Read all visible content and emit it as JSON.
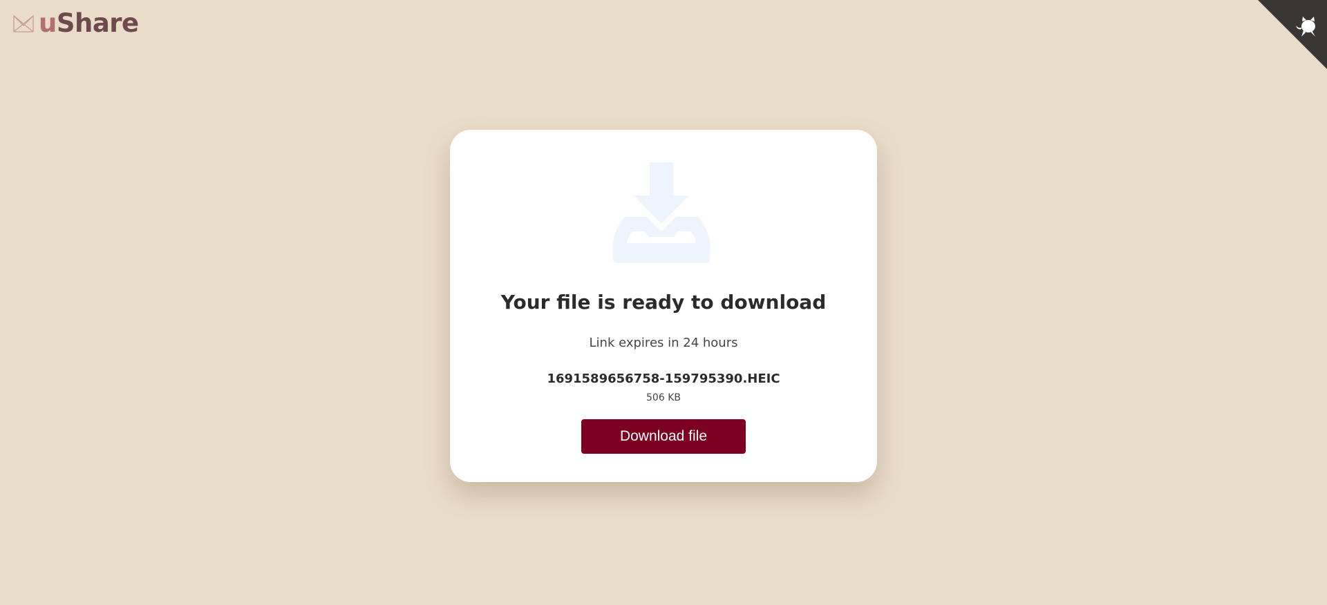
{
  "brand": {
    "name_prefix": "u",
    "name_suffix": "Share",
    "logo_icon": "ushare-logo-icon",
    "colors": {
      "prefix": "#b07070",
      "suffix": "#6e4a4e"
    }
  },
  "corner": {
    "icon": "github-octocat-icon",
    "color": "#3b3535"
  },
  "card": {
    "icon": "download-tray-icon",
    "title": "Your file is ready to download",
    "expiry": "Link expires in 24 hours",
    "file_name": "1691589656758-159795390.HEIC",
    "file_size": "506 KB",
    "button_label": "Download file",
    "button_color": "#7d0020"
  },
  "page": {
    "background": "#e9dcc9"
  }
}
